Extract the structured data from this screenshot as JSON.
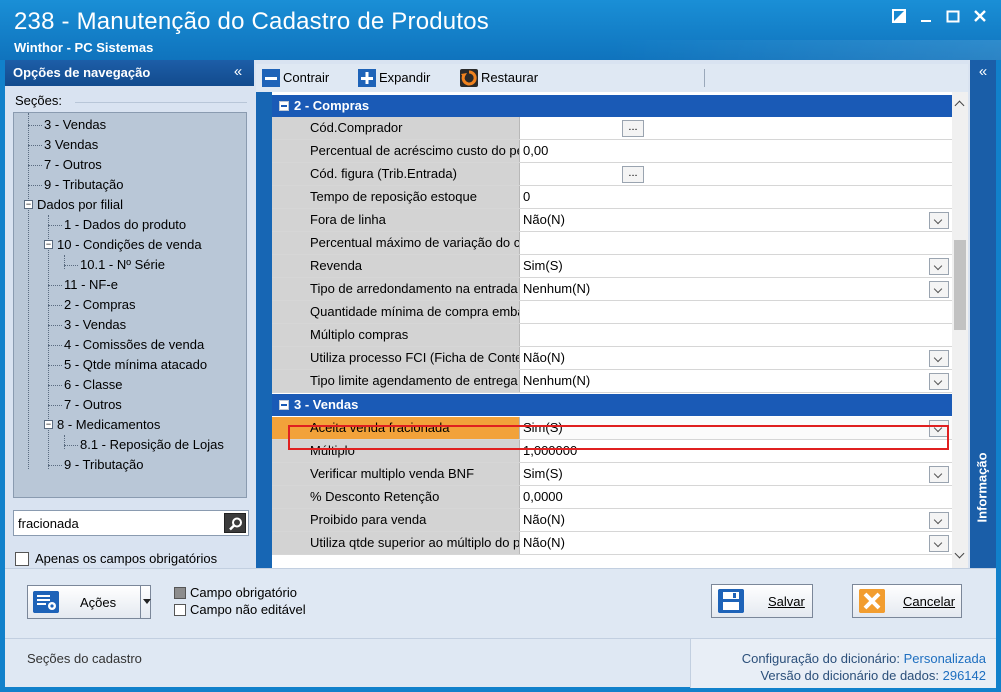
{
  "window": {
    "title": "238 - Manutenção do Cadastro de Produtos",
    "subtitle": "Winthor - PC Sistemas"
  },
  "nav": {
    "header": "Opções de navegação",
    "secoes_label": "Seções:",
    "tree": [
      "3 - Vendas",
      "3 Vendas",
      "7 - Outros",
      "9 - Tributação",
      "Dados por filial",
      "1 - Dados do produto",
      "10 - Condições de venda",
      "10.1 - Nº Série",
      "11 - NF-e",
      "2 - Compras",
      "3 - Vendas",
      "4 - Comissões de venda",
      "5 - Qtde mínima atacado",
      "6 - Classe",
      "7 - Outros",
      "8 - Medicamentos",
      "8.1 -  Reposição de Lojas",
      "9 - Tributação"
    ],
    "search_value": "fracionada",
    "required_only_label": "Apenas os campos obrigatórios"
  },
  "toolbar": {
    "contrair": "Contrair",
    "expandir": "Expandir",
    "restaurar": "Restaurar"
  },
  "info_panel": {
    "label": "Informação"
  },
  "grid": {
    "cat_compras": "2 - Compras",
    "cat_vendas": "3 - Vendas",
    "compras_rows": [
      {
        "name": "Cód.Comprador",
        "value": ""
      },
      {
        "name": "Percentual de acréscimo custo do pedido",
        "value": "0,00"
      },
      {
        "name": "Cód. figura (Trib.Entrada)",
        "value": ""
      },
      {
        "name": "Tempo de reposição estoque",
        "value": "0"
      },
      {
        "name": "Fora de linha",
        "value": "Não(N)"
      },
      {
        "name": "Percentual máximo de variação do custo",
        "value": ""
      },
      {
        "name": "Revenda",
        "value": "Sim(S)"
      },
      {
        "name": "Tipo de arredondamento na entrada",
        "value": "Nenhum(N)"
      },
      {
        "name": "Quantidade mínima de compra embalagem",
        "value": ""
      },
      {
        "name": "Múltiplo compras",
        "value": ""
      },
      {
        "name": "Utiliza processo FCI (Ficha de Conteúdo de Importação)",
        "value": "Não(N)"
      },
      {
        "name": "Tipo limite agendamento de entrega",
        "value": "Nenhum(N)"
      }
    ],
    "vendas_rows": [
      {
        "name": "Aceita venda fracionada",
        "value": "Sim(S)"
      },
      {
        "name": "Múltiplo",
        "value": "1,000000"
      },
      {
        "name": "Verificar multiplo venda BNF",
        "value": "Sim(S)"
      },
      {
        "name": "% Desconto Retenção",
        "value": "0,0000"
      },
      {
        "name": "Proibido para venda",
        "value": "Não(N)"
      },
      {
        "name": "Utiliza qtde superior ao múltiplo do produto",
        "value": "Não(N)"
      }
    ]
  },
  "buttons": {
    "acoes": "Ações",
    "legend_required": "Campo obrigatório",
    "legend_readonly": "Campo não editável",
    "salvar": "Salvar",
    "cancelar": "Cancelar"
  },
  "status": {
    "left": "Seções do cadastro",
    "config_label": "Configuração do dicionário:",
    "config_value": "Personalizada",
    "version_label": "Versão do dicionário de dados:",
    "version_value": "296142"
  },
  "colors": {
    "title_bar": "#1181cb",
    "category": "#1a5ab6",
    "highlight_row": "#f2a23a",
    "highlight_border": "#e02020"
  }
}
